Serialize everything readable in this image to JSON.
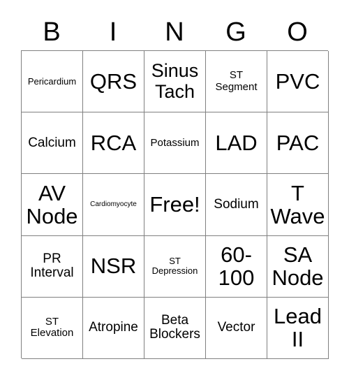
{
  "card": {
    "title_letters": [
      "B",
      "I",
      "N",
      "G",
      "O"
    ],
    "free_space_label": "Free!",
    "grid": {
      "columns": 5,
      "rows": 5,
      "cells": [
        [
          {
            "text": "Pericardium",
            "size": "xs"
          },
          {
            "text": "QRS",
            "size": "xxl"
          },
          {
            "text": "Sinus Tach",
            "size": "xl"
          },
          {
            "text": "ST Segment",
            "size": "s"
          },
          {
            "text": "PVC",
            "size": "xxl"
          }
        ],
        [
          {
            "text": "Calcium",
            "size": "m"
          },
          {
            "text": "RCA",
            "size": "xxl"
          },
          {
            "text": "Potassium",
            "size": "s"
          },
          {
            "text": "LAD",
            "size": "xxl"
          },
          {
            "text": "PAC",
            "size": "xxl"
          }
        ],
        [
          {
            "text": "AV Node",
            "size": "xxl"
          },
          {
            "text": "Cardiomyocyte",
            "size": "xxs"
          },
          {
            "text": "Free!",
            "size": "xxl"
          },
          {
            "text": "Sodium",
            "size": "m"
          },
          {
            "text": "T Wave",
            "size": "xxl"
          }
        ],
        [
          {
            "text": "PR Interval",
            "size": "m"
          },
          {
            "text": "NSR",
            "size": "xxl"
          },
          {
            "text": "ST Depression",
            "size": "xs"
          },
          {
            "text": "60-100",
            "size": "xxl"
          },
          {
            "text": "SA Node",
            "size": "xxl"
          }
        ],
        [
          {
            "text": "ST Elevation",
            "size": "s"
          },
          {
            "text": "Atropine",
            "size": "m"
          },
          {
            "text": "Beta Blockers",
            "size": "m"
          },
          {
            "text": "Vector",
            "size": "m"
          },
          {
            "text": "Lead II",
            "size": "xxl"
          }
        ]
      ]
    },
    "colors": {
      "background": "#ffffff",
      "text": "#000000",
      "grid_line": "#808080"
    }
  }
}
